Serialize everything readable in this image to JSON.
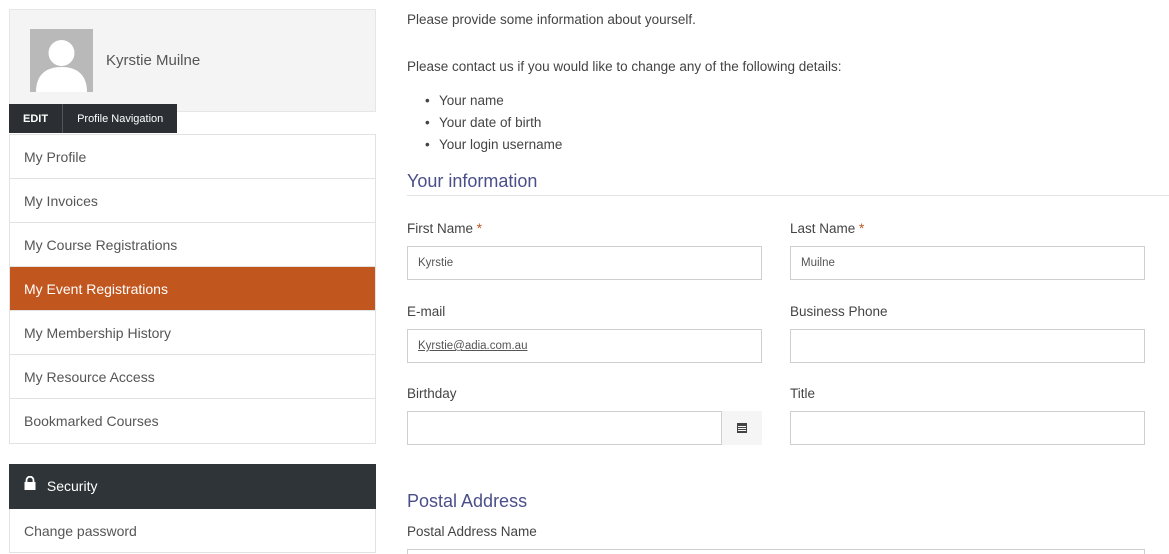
{
  "profile": {
    "name": "Kyrstie Muilne",
    "tab_edit": "EDIT",
    "tab_nav": "Profile Navigation"
  },
  "nav": {
    "items": [
      {
        "label": "My Profile"
      },
      {
        "label": "My Invoices"
      },
      {
        "label": "My Course Registrations"
      },
      {
        "label": "My Event Registrations"
      },
      {
        "label": "My Membership History"
      },
      {
        "label": "My Resource Access"
      },
      {
        "label": "Bookmarked Courses"
      }
    ],
    "active_index": 3
  },
  "security": {
    "header": "Security",
    "change_password": "Change password"
  },
  "main": {
    "intro": "Please provide some information about yourself.",
    "contact": "Please contact us if you would like to change any of the following details:",
    "bullets": [
      "Your name",
      "Your date of birth",
      "Your login username"
    ],
    "section_info": "Your information",
    "section_postal": "Postal Address"
  },
  "form": {
    "first_name_label": "First Name",
    "first_name_value": "Kyrstie",
    "last_name_label": "Last Name",
    "last_name_value": "Muilne",
    "required_mark": "*",
    "email_label": "E-mail",
    "email_value": "Kyrstie@adia.com.au",
    "business_phone_label": "Business Phone",
    "business_phone_value": "",
    "birthday_label": "Birthday",
    "birthday_value": "",
    "title_label": "Title",
    "title_value": "",
    "postal_name_label": "Postal Address Name"
  },
  "colors": {
    "accent": "#c2561f",
    "dark": "#2f3438",
    "heading": "#4a4f8a"
  },
  "icons": {
    "avatar": "avatar-placeholder-icon",
    "lock": "lock-icon",
    "calendar": "calendar-icon"
  }
}
